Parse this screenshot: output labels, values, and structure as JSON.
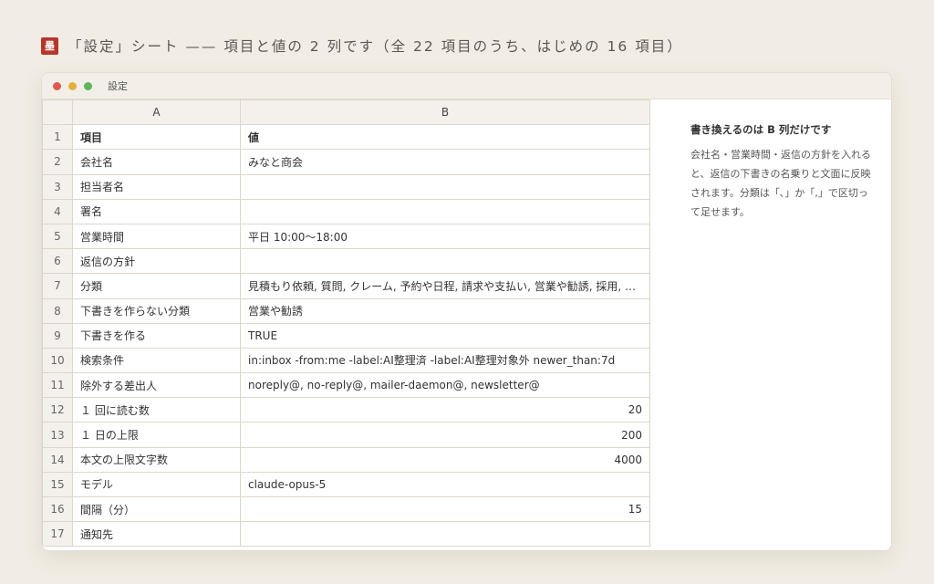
{
  "caption": {
    "seal": "墨",
    "text": "「設定」シート —— 項目と値の 2 列です（全 22 項目のうち、はじめの 16 項目）"
  },
  "window": {
    "title": "設定"
  },
  "sheet": {
    "columns": [
      "A",
      "B"
    ],
    "rows": [
      {
        "n": "1",
        "key": "項目",
        "value": "値"
      },
      {
        "n": "2",
        "key": "会社名",
        "value": "みなと商会"
      },
      {
        "n": "3",
        "key": "担当者名",
        "value": ""
      },
      {
        "n": "4",
        "key": "署名",
        "value": ""
      },
      {
        "n": "5",
        "key": "営業時間",
        "value": "平日 10:00〜18:00"
      },
      {
        "n": "6",
        "key": "返信の方針",
        "value": ""
      },
      {
        "n": "7",
        "key": "分類",
        "value": "見積もり依頼, 質問, クレーム, 予約や日程, 請求や支払い, 営業や勧誘, 採用, その他"
      },
      {
        "n": "8",
        "key": "下書きを作らない分類",
        "value": "営業や勧誘"
      },
      {
        "n": "9",
        "key": "下書きを作る",
        "value": "TRUE"
      },
      {
        "n": "10",
        "key": "検索条件",
        "value": "in:inbox -from:me -label:AI整理済 -label:AI整理対象外 newer_than:7d"
      },
      {
        "n": "11",
        "key": "除外する差出人",
        "value": "noreply@, no-reply@, mailer-daemon@, newsletter@"
      },
      {
        "n": "12",
        "key": "１ 回に読む数",
        "value": "20",
        "numeric": true
      },
      {
        "n": "13",
        "key": "１ 日の上限",
        "value": "200",
        "numeric": true
      },
      {
        "n": "14",
        "key": "本文の上限文字数",
        "value": "4000",
        "numeric": true
      },
      {
        "n": "15",
        "key": "モデル",
        "value": "claude-opus-5"
      },
      {
        "n": "16",
        "key": "間隔（分）",
        "value": "15",
        "numeric": true
      },
      {
        "n": "17",
        "key": "通知先",
        "value": ""
      }
    ]
  },
  "side_note": {
    "title": "書き換えるのは B 列だけです",
    "body": "会社名・営業時間・返信の方針を入れると、返信の下書きの名乗りと文面に反映されます。分類は「､」か「,」で区切って足せます。"
  }
}
